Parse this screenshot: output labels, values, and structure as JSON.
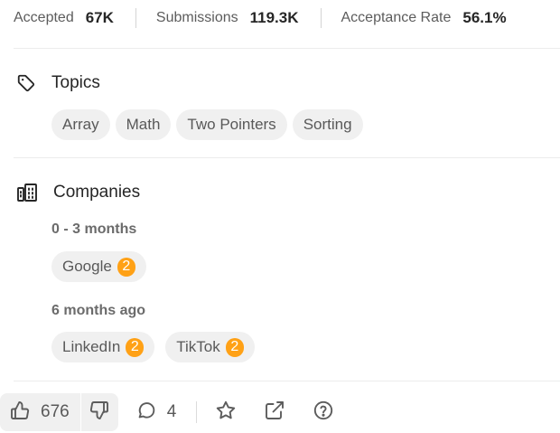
{
  "stats": {
    "accepted_label": "Accepted",
    "accepted_value": "67K",
    "submissions_label": "Submissions",
    "submissions_value": "119.3K",
    "acceptance_rate_label": "Acceptance Rate",
    "acceptance_rate_value": "56.1%"
  },
  "topics": {
    "title": "Topics",
    "icon": "tag-icon",
    "tags": [
      "Array",
      "Math",
      "Two Pointers",
      "Sorting"
    ]
  },
  "companies": {
    "title": "Companies",
    "icon": "building-icon",
    "periods": [
      {
        "label": "0 - 3 months",
        "companies": [
          {
            "name": "Google",
            "count": "2"
          }
        ]
      },
      {
        "label": "6 months ago",
        "companies": [
          {
            "name": "LinkedIn",
            "count": "2"
          },
          {
            "name": "TikTok",
            "count": "2"
          }
        ]
      }
    ]
  },
  "actions": {
    "likes": "676",
    "comments": "4",
    "icons": [
      "thumbs-up-icon",
      "thumbs-down-icon",
      "comment-icon",
      "star-icon",
      "share-icon",
      "help-icon"
    ]
  },
  "colors": {
    "badge": "#ffa116",
    "chip_background": "#f0f0f0",
    "divider": "#ececec"
  }
}
